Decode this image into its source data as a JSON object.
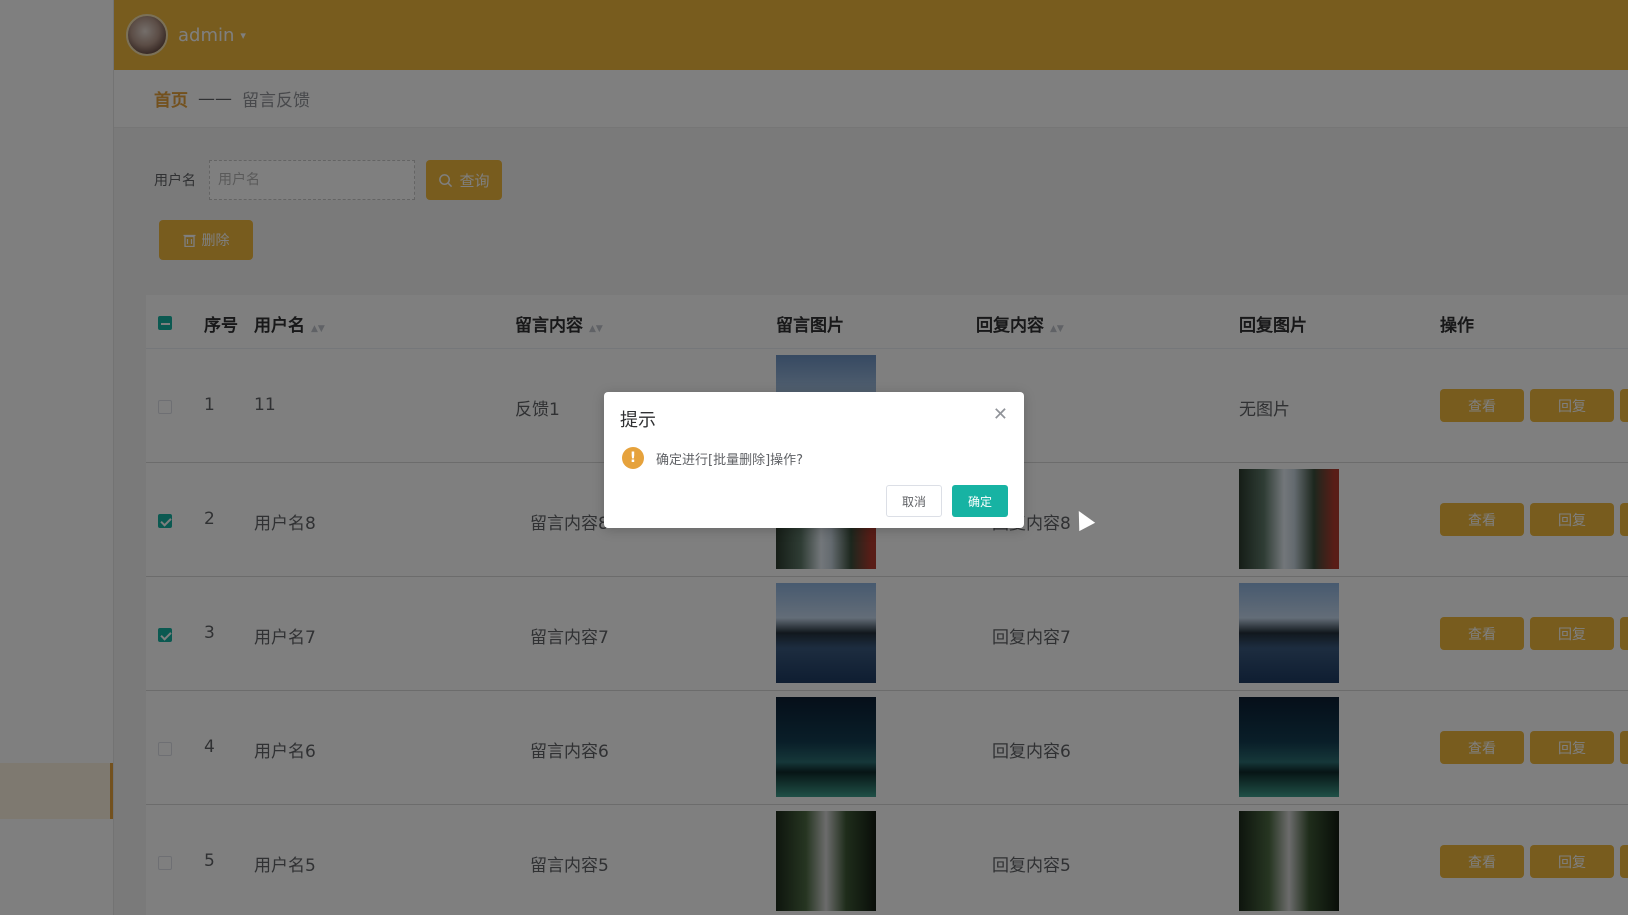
{
  "header": {
    "username": "admin",
    "caret": "▾"
  },
  "breadcrumb": {
    "home": "首页",
    "separator": "——",
    "current": "留言反馈"
  },
  "search": {
    "label": "用户名",
    "placeholder": "用户名",
    "query_label": "查询",
    "query_icon": "search-icon"
  },
  "toolbar": {
    "delete_label": "删除",
    "delete_icon": "trash-icon"
  },
  "table": {
    "columns": [
      "序号",
      "用户名",
      "留言内容",
      "留言图片",
      "回复内容",
      "回复图片",
      "操作"
    ],
    "rows": [
      {
        "index": "1",
        "username": "11",
        "content": "反馈1",
        "image": "sky",
        "reply": "",
        "reply_image_text": "无图片",
        "reply_image": "",
        "checked": false
      },
      {
        "index": "2",
        "username": "用户名8",
        "content": "留言内容8",
        "image": "waterfall",
        "reply": "回复内容8",
        "reply_image_text": "",
        "reply_image": "waterfall",
        "checked": true
      },
      {
        "index": "3",
        "username": "用户名7",
        "content": "留言内容7",
        "image": "lake",
        "reply": "回复内容7",
        "reply_image_text": "",
        "reply_image": "lake",
        "checked": true
      },
      {
        "index": "4",
        "username": "用户名6",
        "content": "留言内容6",
        "image": "night",
        "reply": "回复内容6",
        "reply_image_text": "",
        "reply_image": "night",
        "checked": false
      },
      {
        "index": "5",
        "username": "用户名5",
        "content": "留言内容5",
        "image": "forest",
        "reply": "回复内容5",
        "reply_image_text": "",
        "reply_image": "forest",
        "checked": false
      }
    ],
    "actions": {
      "view": "查看",
      "reply": "回复"
    }
  },
  "dialog": {
    "title": "提示",
    "message": "确定进行[批量删除]操作?",
    "cancel": "取消",
    "confirm": "确定",
    "close_icon": "close-icon",
    "warning_icon": "warning-icon"
  },
  "colors": {
    "accent": "#f0b83c",
    "primary": "#17b3a3",
    "warning": "#e6a23c"
  }
}
